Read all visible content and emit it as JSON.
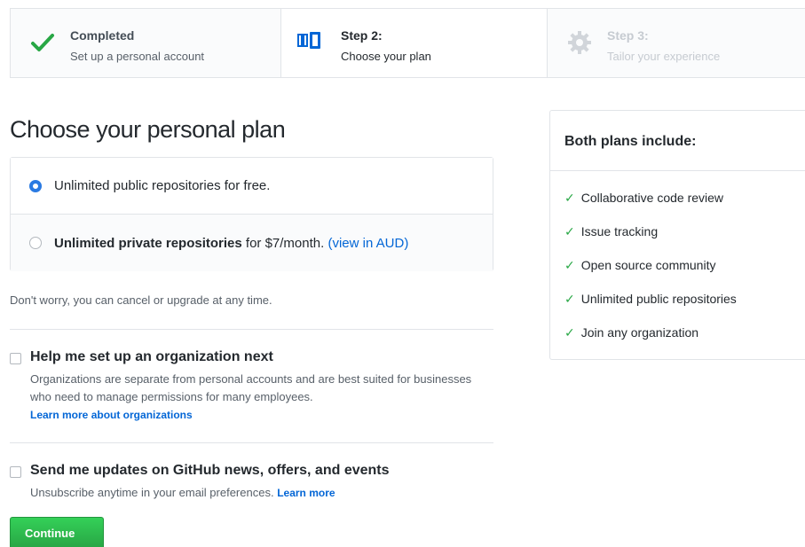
{
  "steps": [
    {
      "title": "Completed",
      "desc": "Set up a personal account",
      "icon": "checkmark-icon",
      "state": "completed"
    },
    {
      "title": "Step 2:",
      "desc": "Choose your plan",
      "icon": "plan-icon",
      "state": "current"
    },
    {
      "title": "Step 3:",
      "desc": "Tailor your experience",
      "icon": "gear-icon",
      "state": "upcoming"
    }
  ],
  "heading": "Choose your personal plan",
  "plans": {
    "free": {
      "label": "Unlimited public repositories for free.",
      "selected": true
    },
    "paid": {
      "label_bold": "Unlimited private repositories",
      "label_rest": " for $7/month.",
      "link": "(view in AUD)",
      "selected": false
    }
  },
  "cancel_note": "Don't worry, you can cancel or upgrade at any time.",
  "options": {
    "org": {
      "title": "Help me set up an organization next",
      "desc": "Organizations are separate from personal accounts and are best suited for businesses who need to manage permissions for many employees.",
      "link": "Learn more about organizations",
      "checked": false
    },
    "updates": {
      "title": "Send me updates on GitHub news, offers, and events",
      "desc": "Unsubscribe anytime in your email preferences.",
      "link": "Learn more",
      "checked": false
    }
  },
  "continue_label": "Continue",
  "sidebar": {
    "title": "Both plans include:",
    "items": [
      "Collaborative code review",
      "Issue tracking",
      "Open source community",
      "Unlimited public repositories",
      "Join any organization"
    ]
  },
  "colors": {
    "accent_green": "#28a745",
    "link_blue": "#0366d6",
    "radio_blue": "#2a7ae2"
  }
}
